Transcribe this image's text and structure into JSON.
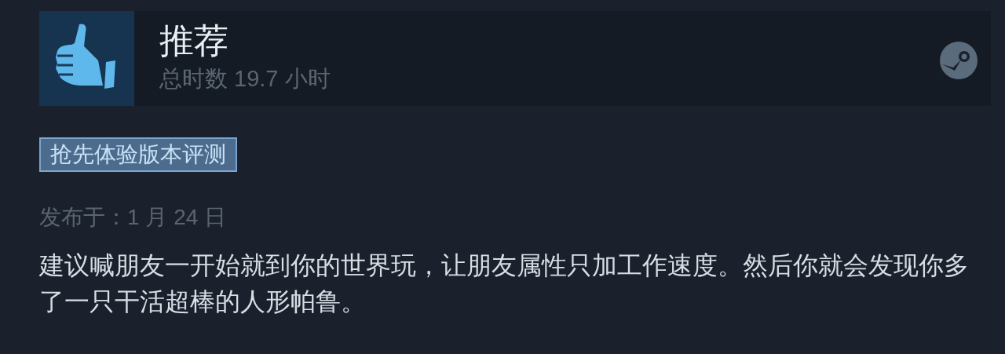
{
  "header": {
    "verdict": "推荐",
    "playtime": "总时数 19.7 小时",
    "recommended": true
  },
  "badge": "抢先体验版本评测",
  "posted": "发布于：1 月 24 日",
  "review_text": "建议喊朋友一开始就到你的世界玩，让朋友属性只加工作速度。然后你就会发现你多了一只干活超棒的人形帕鲁。"
}
